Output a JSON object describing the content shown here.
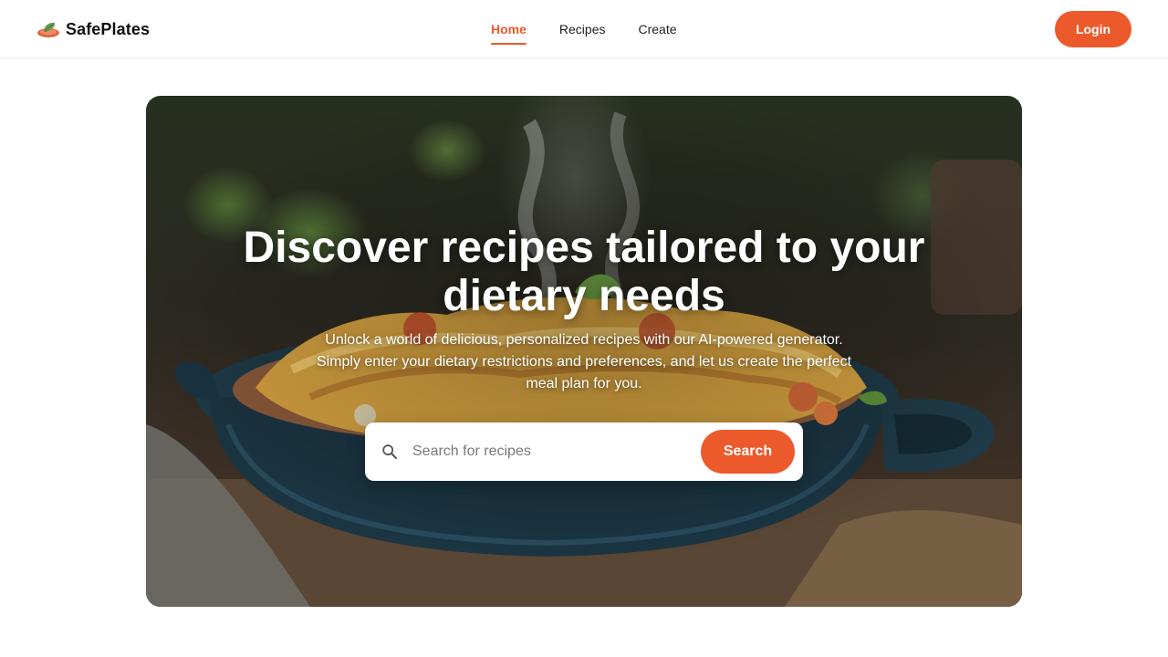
{
  "brand": {
    "name": "SafePlates",
    "logo_icon": "leaf-plate-icon"
  },
  "nav": {
    "items": [
      {
        "label": "Home",
        "active": true
      },
      {
        "label": "Recipes",
        "active": false
      },
      {
        "label": "Create",
        "active": false
      }
    ]
  },
  "header": {
    "login_label": "Login"
  },
  "hero": {
    "title": "Discover recipes tailored to your dietary needs",
    "subtitle": "Unlock a world of delicious, personalized recipes with our AI-powered generator. Simply enter your dietary restrictions and preferences, and let us create the perfect meal plan for you.",
    "image": "lasagna-dish-image"
  },
  "search": {
    "placeholder": "Search for recipes",
    "value": "",
    "button_label": "Search",
    "icon": "search-icon"
  },
  "colors": {
    "accent": "#ec5a2c",
    "text": "#1a1a1a",
    "background": "#ffffff"
  }
}
